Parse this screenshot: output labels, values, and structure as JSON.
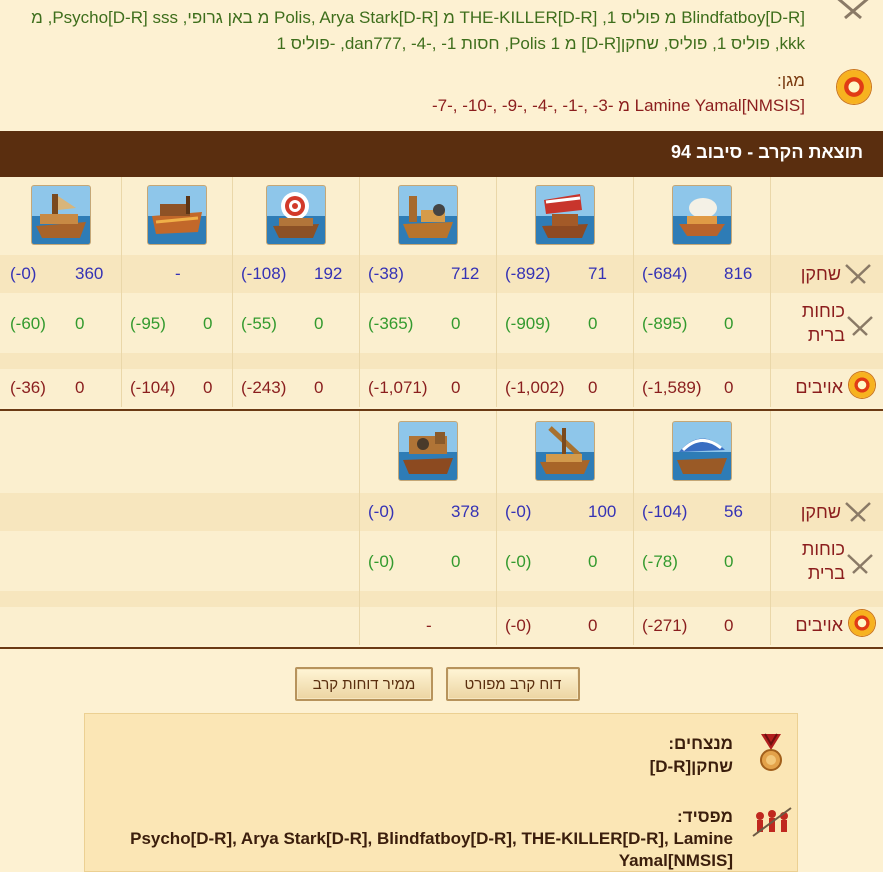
{
  "attacker": {
    "line1": "Blindfatboy[D-R] מ פוליס 1, THE-KILLER[D-R] מ Polis, Arya Stark[D-R] מ באן גרופי, Psycho[D-R] sss, מ",
    "line2": "kkk, פוליס 1, פוליס, שחקן[D-R] מ Polis 1, חסות 1- ,-4- ,dan777, -פוליס 1"
  },
  "defender": {
    "label": "מגן:",
    "line": "Lamine Yamal[NMSIS] מ -3- ,-1- ,-4- ,-9- ,-10- ,-7-"
  },
  "round": {
    "title": "תוצאת הקרב - סיבוב 94"
  },
  "rows": {
    "player": "שחקן",
    "allies": "כוחות ברית",
    "enemies": "אויבים"
  },
  "table1": {
    "ships": [
      "ship-1",
      "ship-2",
      "ship-3",
      "ship-4",
      "ship-5",
      "ship-6"
    ],
    "player": [
      [
        "816",
        "(684-)"
      ],
      [
        "71",
        "(892-)"
      ],
      [
        "712",
        "(38-)"
      ],
      [
        "192",
        "(108-)"
      ],
      [
        "",
        "-"
      ],
      [
        "360",
        "(0-)"
      ]
    ],
    "allies": [
      [
        "0",
        "(895-)"
      ],
      [
        "0",
        "(909-)"
      ],
      [
        "0",
        "(365-)"
      ],
      [
        "0",
        "(55-)"
      ],
      [
        "0",
        "(95-)"
      ],
      [
        "0",
        "(60-)"
      ]
    ],
    "enemies": [
      [
        "0",
        "(1,589-)"
      ],
      [
        "0",
        "(1,002-)"
      ],
      [
        "0",
        "(1,071-)"
      ],
      [
        "0",
        "(243-)"
      ],
      [
        "0",
        "(104-)"
      ],
      [
        "0",
        "(36-)"
      ]
    ]
  },
  "table2": {
    "player": [
      [
        "56",
        "(104-)"
      ],
      [
        "100",
        "(0-)"
      ],
      [
        "378",
        "(0-)"
      ]
    ],
    "allies": [
      [
        "0",
        "(78-)"
      ],
      [
        "0",
        "(0-)"
      ],
      [
        "0",
        "(0-)"
      ]
    ],
    "enemies": [
      [
        "0",
        "(271-)"
      ],
      [
        "0",
        "(0-)"
      ],
      [
        "",
        "-"
      ]
    ]
  },
  "buttons": {
    "detailed": "דוח קרב מפורט",
    "converter": "ממיר דוחות קרב"
  },
  "result": {
    "winners_label": "מנצחים:",
    "winners": "שחקן[D-R]",
    "loser_label": "מפסיד:",
    "losers_line1": "Psycho[D-R], Arya Stark[D-R], Blindfatboy[D-R], THE-KILLER[D-R], Lamine",
    "losers_line2": "Yamal[NMSIS]"
  },
  "colors": {
    "header_bg": "#5a2e0f",
    "player_value": "#3532b5",
    "ally_value": "#339a2e",
    "enemy_value": "#8a1e1e"
  }
}
